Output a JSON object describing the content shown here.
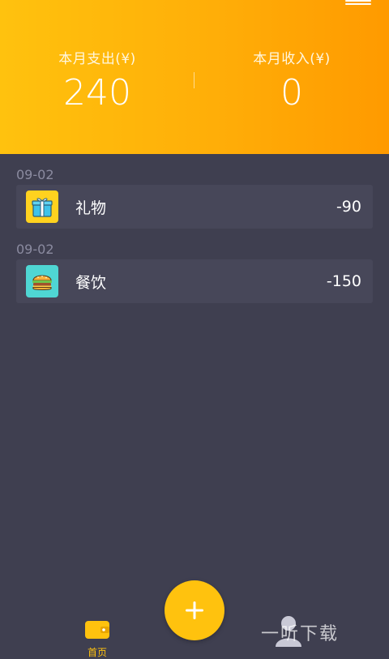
{
  "header": {
    "expense_label": "本月支出(¥)",
    "expense_value": "240",
    "income_label": "本月收入(¥)",
    "income_value": "0"
  },
  "records": [
    {
      "date": "09-02",
      "category": "礼物",
      "amount": "-90",
      "icon": "gift-icon"
    },
    {
      "date": "09-02",
      "category": "餐饮",
      "amount": "-150",
      "icon": "burger-icon"
    }
  ],
  "tabbar": {
    "home_label": "首页",
    "add_icon": "plus-icon",
    "mine_icon": "user-icon"
  },
  "watermark": "一听下载",
  "colors": {
    "accent": "#ffc20e",
    "header_end": "#ff9a00",
    "background": "#3f3f50",
    "card": "#474759"
  }
}
